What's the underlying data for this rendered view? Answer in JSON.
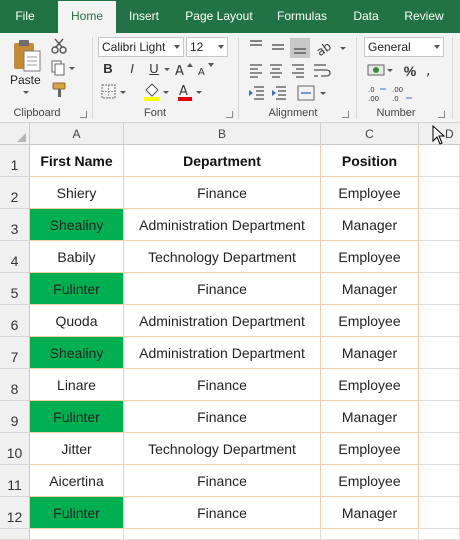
{
  "tabs": [
    {
      "label": "File",
      "active": false
    },
    {
      "label": "Home",
      "active": true
    },
    {
      "label": "Insert",
      "active": false
    },
    {
      "label": "Page Layout",
      "active": false
    },
    {
      "label": "Formulas",
      "active": false
    },
    {
      "label": "Data",
      "active": false
    },
    {
      "label": "Review",
      "active": false
    }
  ],
  "ribbon": {
    "clipboard": {
      "label": "Clipboard",
      "paste_label": "Paste"
    },
    "font": {
      "label": "Font",
      "name": "Calibri Light",
      "size": "12",
      "bold": "B",
      "italic": "I",
      "underline": "U"
    },
    "alignment": {
      "label": "Alignment"
    },
    "number": {
      "label": "Number",
      "format": "General",
      "percent": "%"
    }
  },
  "colors": {
    "accent": "#217346",
    "highlight": "#00b050",
    "gridline_orange": "#f5cfa8"
  },
  "columns": [
    "A",
    "B",
    "C",
    "D"
  ],
  "table": {
    "headers": [
      "First Name",
      "Department",
      "Position"
    ],
    "rows": [
      {
        "num": "2",
        "name": "Shiery",
        "dept": "Finance",
        "pos": "Employee",
        "highlight": false
      },
      {
        "num": "3",
        "name": "Shealiny",
        "dept": "Administration Department",
        "pos": "Manager",
        "highlight": true
      },
      {
        "num": "4",
        "name": "Babily",
        "dept": "Technology Department",
        "pos": "Employee",
        "highlight": false
      },
      {
        "num": "5",
        "name": "Fulinter",
        "dept": "Finance",
        "pos": "Manager",
        "highlight": true
      },
      {
        "num": "6",
        "name": "Quoda",
        "dept": "Administration Department",
        "pos": "Employee",
        "highlight": false
      },
      {
        "num": "7",
        "name": "Shealiny",
        "dept": "Administration Department",
        "pos": "Manager",
        "highlight": true
      },
      {
        "num": "8",
        "name": "Linare",
        "dept": "Finance",
        "pos": "Employee",
        "highlight": false
      },
      {
        "num": "9",
        "name": "Fulinter",
        "dept": "Finance",
        "pos": "Manager",
        "highlight": true
      },
      {
        "num": "10",
        "name": "Jitter",
        "dept": "Technology Department",
        "pos": "Employee",
        "highlight": false
      },
      {
        "num": "11",
        "name": "Aicertina",
        "dept": "Finance",
        "pos": "Employee",
        "highlight": false
      },
      {
        "num": "12",
        "name": "Fulinter",
        "dept": "Finance",
        "pos": "Manager",
        "highlight": true
      }
    ],
    "header_row_num": "1"
  }
}
